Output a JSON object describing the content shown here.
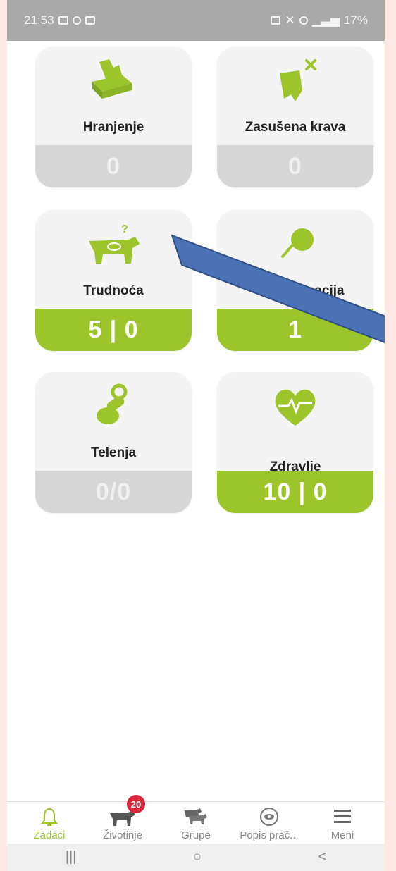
{
  "status_bar": {
    "time": "21:53",
    "battery": "17%"
  },
  "tiles": [
    {
      "label": "Hranjenje",
      "count": "0",
      "icon": "feeding-icon",
      "active": false
    },
    {
      "label": "Zasušena krava",
      "count": "0",
      "icon": "dry-cow-icon",
      "active": false
    },
    {
      "label": "Trudnoća",
      "count": "5 | 0",
      "icon": "pregnancy-cow-icon",
      "active": true
    },
    {
      "label": "inacija",
      "count": "1",
      "icon": "insemination-icon",
      "active": true
    },
    {
      "label": "Telenja",
      "count": "0/0",
      "icon": "pacifier-icon",
      "active": false
    },
    {
      "label": "Zdravlje",
      "count": "10 | 0",
      "icon": "heart-pulse-icon",
      "active": true
    }
  ],
  "bottom_nav": {
    "items": [
      {
        "label": "Zadaci",
        "icon": "bell-icon"
      },
      {
        "label": "Životinje",
        "icon": "cow-icon",
        "badge": "20"
      },
      {
        "label": "Grupe",
        "icon": "herd-icon"
      },
      {
        "label": "Popis prač...",
        "icon": "eye-icon"
      },
      {
        "label": "Meni",
        "icon": "menu-icon"
      }
    ]
  },
  "system_nav": {
    "recents": "|||",
    "home": "○",
    "back": "<"
  },
  "colors": {
    "accent": "#9cc52c",
    "inactive_count": "#d6d6d6",
    "badge": "#d9263c",
    "arrow": "#4a72b5"
  }
}
